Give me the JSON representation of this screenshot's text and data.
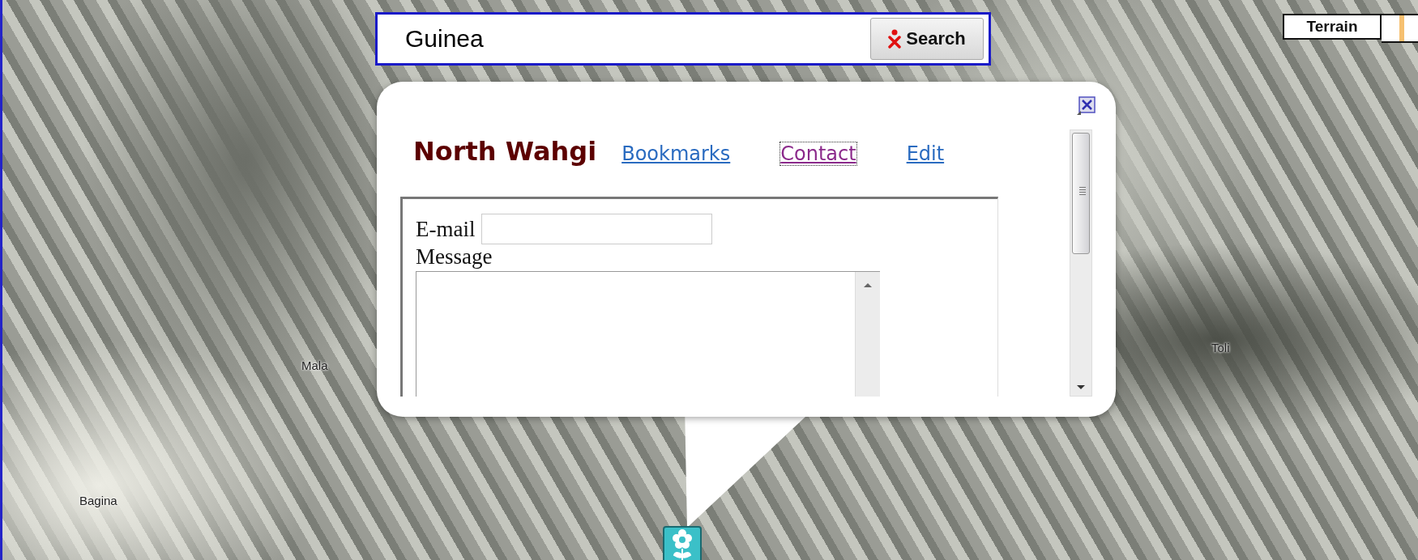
{
  "search": {
    "value": "Guinea",
    "button": "Search"
  },
  "map_type_buttons": [
    {
      "label": "Terrain"
    }
  ],
  "map_labels": [
    {
      "text": "Mala"
    },
    {
      "text": "Bagina"
    },
    {
      "text": "Toli"
    }
  ],
  "popup": {
    "title": "North Wahgi",
    "links": [
      {
        "label": "Bookmarks",
        "selected": false
      },
      {
        "label": "Contact",
        "selected": true
      },
      {
        "label": "Edit",
        "selected": false
      }
    ],
    "fields": [
      {
        "label": "E-mail",
        "kind": "input"
      },
      {
        "label": "Message",
        "kind": "textarea"
      }
    ]
  }
}
